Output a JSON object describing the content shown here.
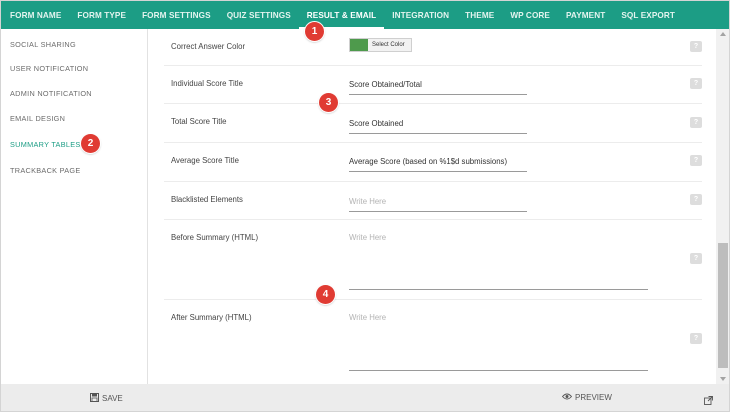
{
  "nav": {
    "tabs": [
      {
        "label": "FORM NAME"
      },
      {
        "label": "FORM TYPE"
      },
      {
        "label": "FORM SETTINGS"
      },
      {
        "label": "QUIZ SETTINGS"
      },
      {
        "label": "RESULT & EMAIL",
        "active": true
      },
      {
        "label": "INTEGRATION"
      },
      {
        "label": "THEME"
      },
      {
        "label": "WP CORE"
      },
      {
        "label": "PAYMENT"
      },
      {
        "label": "SQL EXPORT"
      }
    ],
    "accent_color": "#1c9d85"
  },
  "sidebar": {
    "items": [
      {
        "label": "SOCIAL SHARING"
      },
      {
        "label": "USER NOTIFICATION"
      },
      {
        "label": "ADMIN NOTIFICATION"
      },
      {
        "label": "EMAIL DESIGN"
      },
      {
        "label": "SUMMARY TABLES",
        "active": true
      },
      {
        "label": "TRACKBACK PAGE"
      }
    ]
  },
  "fields": {
    "correct_answer_color": {
      "label": "Correct Answer Color",
      "button": "Select Color",
      "color": "#4e9a4c"
    },
    "individual_score": {
      "label": "Individual Score Title",
      "value": "Score Obtained/Total"
    },
    "total_score": {
      "label": "Total Score Title",
      "value": "Score Obtained"
    },
    "average_score": {
      "label": "Average Score Title",
      "value": "Average Score (based on %1$d submissions)"
    },
    "blacklisted": {
      "label": "Blacklisted Elements",
      "placeholder": "Write Here"
    },
    "before_summary": {
      "label": "Before Summary (HTML)",
      "placeholder": "Write Here"
    },
    "after_summary": {
      "label": "After Summary (HTML)",
      "placeholder": "Write Here"
    }
  },
  "help_icon": "?",
  "footer": {
    "save_label": "SAVE",
    "preview_label": "PREVIEW",
    "save_icon": "floppy-icon",
    "preview_icon": "eye-icon",
    "external_icon": "external-link-icon"
  },
  "markers": [
    "1",
    "2",
    "3",
    "4"
  ],
  "marker_color": "#e03b33"
}
